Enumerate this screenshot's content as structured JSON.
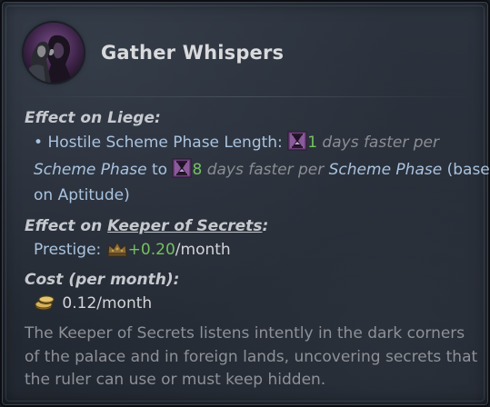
{
  "title": "Gather Whispers",
  "effect_liege": {
    "heading": "Effect on Liege:",
    "bullet": "•",
    "label": "Hostile Scheme Phase Length:",
    "value_min": "1",
    "text_faster_per_1": "days faster per",
    "scheme_phase_1": "Scheme Phase",
    "to": "to",
    "value_max": "8",
    "text_faster_per_2": "days faster per",
    "scheme_phase_2": "Scheme Phase",
    "based": "(based",
    "on_aptitude": "on Aptitude)",
    "icon": "hourglass-icon"
  },
  "effect_keeper": {
    "heading_prefix": "Effect on ",
    "heading_link": "Keeper of Secrets",
    "heading_suffix": ":",
    "prestige_label": "Prestige:",
    "prestige_value": "+0.20",
    "prestige_unit": "/month",
    "icon": "crown-icon"
  },
  "cost": {
    "heading": "Cost (per month):",
    "value": "0.12/month",
    "icon": "gold-coins-icon"
  },
  "flavor": {
    "line1": "The Keeper of Secrets listens intently in the dark corners",
    "line2": "of the palace and in foreign lands, uncovering secrets that",
    "line3": "the ruler can use or must keep hidden."
  },
  "colors": {
    "background": "#272d37",
    "green": "#74c160",
    "blue": "#a9c3df",
    "hourglass_purple": "#6b3f7a"
  }
}
